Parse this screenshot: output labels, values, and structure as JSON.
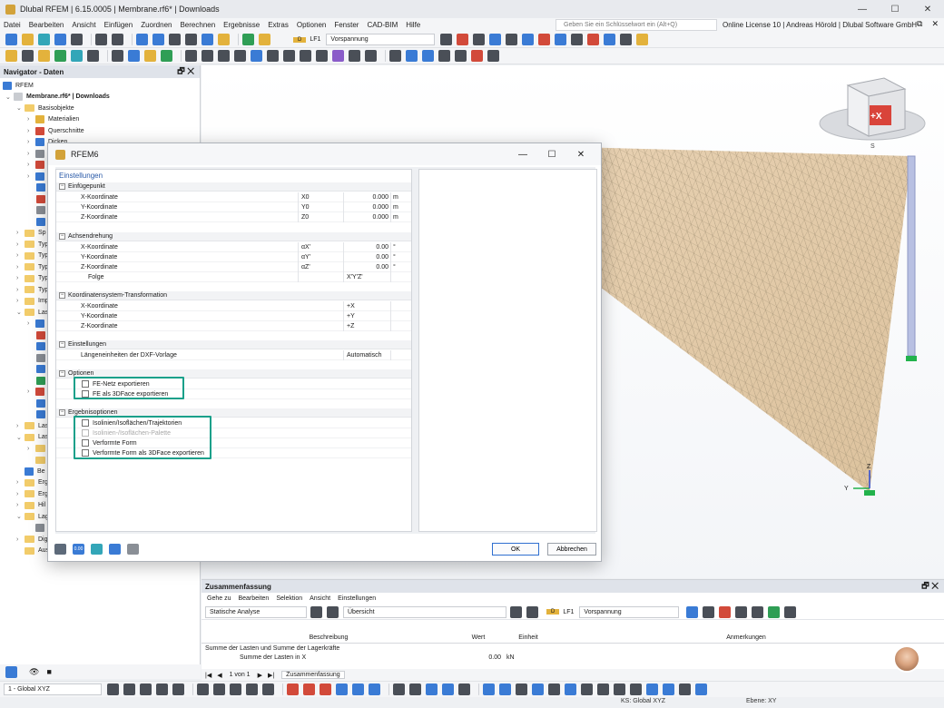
{
  "window": {
    "title": "Dlubal RFEM | 6.15.0005 | Membrane.rf6* | Downloads",
    "min": "—",
    "max": "☐",
    "close": "✕"
  },
  "menu": {
    "items": [
      "Datei",
      "Bearbeiten",
      "Ansicht",
      "Einfügen",
      "Zuordnen",
      "Berechnen",
      "Ergebnisse",
      "Extras",
      "Optionen",
      "Fenster",
      "CAD-BIM",
      "Hilfe"
    ],
    "search_placeholder": "Geben Sie ein Schlüsselwort ein (Alt+Q)",
    "license": "Online License 10 | Andreas Hörold | Dlubal Software GmbH"
  },
  "toolbar": {
    "lf_tag": "D",
    "lf_id": "LF1",
    "lf_name": "Vorspannung"
  },
  "navigator": {
    "title": "Navigator - Daten",
    "root": "RFEM",
    "model": "Membrane.rf6* | Downloads",
    "items": [
      "Basisobjekte",
      "Materialien",
      "Querschnitte",
      "Dicken",
      "Sp",
      "Typ",
      "Typ",
      "Typ",
      "Typ",
      "Typ",
      "Imp",
      "Las",
      "Las",
      "Las",
      "Be",
      "Erg",
      "Erg",
      "Hil",
      "Lag",
      "Dig",
      "Ausdruckprotokolle"
    ]
  },
  "viewport": {
    "cube_label": "+X",
    "cube_corner": "S",
    "axis_y": "Y",
    "axis_z": "Z"
  },
  "dialog": {
    "title": "RFEM6",
    "settings_title": "Einstellungen",
    "sections": {
      "insertion": "Einfügepunkt",
      "rotation": "Achsendrehung",
      "transform": "Koordinatensystem-Transformation",
      "settings": "Einstellungen",
      "options": "Optionen",
      "results": "Ergebnisoptionen"
    },
    "insertion_rows": [
      {
        "label": "X-Koordinate",
        "symbol": "X0",
        "value": "0.000",
        "unit": "m"
      },
      {
        "label": "Y-Koordinate",
        "symbol": "Y0",
        "value": "0.000",
        "unit": "m"
      },
      {
        "label": "Z-Koordinate",
        "symbol": "Z0",
        "value": "0.000",
        "unit": "m"
      }
    ],
    "rotation_rows": [
      {
        "label": "X-Koordinate",
        "symbol": "αX'",
        "value": "0.00",
        "unit": "°"
      },
      {
        "label": "Y-Koordinate",
        "symbol": "αY'",
        "value": "0.00",
        "unit": "°"
      },
      {
        "label": "Z-Koordinate",
        "symbol": "αZ'",
        "value": "0.00",
        "unit": "°"
      },
      {
        "label": "Folge",
        "symbol": "X'Y'Z'",
        "value": "",
        "unit": ""
      }
    ],
    "transform_rows": [
      {
        "label": "X-Koordinate",
        "symbol": "+X",
        "value": "",
        "unit": ""
      },
      {
        "label": "Y-Koordinate",
        "symbol": "+Y",
        "value": "",
        "unit": ""
      },
      {
        "label": "Z-Koordinate",
        "symbol": "+Z",
        "value": "",
        "unit": ""
      }
    ],
    "settings_rows": [
      {
        "label": "Längeneinheiten der DXF-Vorlage",
        "symbol": "Automatisch",
        "value": "",
        "unit": ""
      }
    ],
    "options_checks": [
      {
        "label": "FE-Netz exportieren",
        "disabled": false
      },
      {
        "label": "FE als 3DFace exportieren",
        "disabled": false
      }
    ],
    "results_checks": [
      {
        "label": "Isolinien/Isoflächen/Trajektorien",
        "disabled": false
      },
      {
        "label": "Isolinien-/Isoflächen-Palette",
        "disabled": true
      },
      {
        "label": "Verformte Form",
        "disabled": false
      },
      {
        "label": "Verformte Form als 3DFace exportieren",
        "disabled": false
      }
    ],
    "ok": "OK",
    "cancel": "Abbrechen",
    "footer_value": "0.00"
  },
  "bottom": {
    "title": "Zusammenfassung",
    "menu": [
      "Gehe zu",
      "Bearbeiten",
      "Selektion",
      "Ansicht",
      "Einstellungen"
    ],
    "analysis": "Statische Analyse",
    "overview": "Übersicht",
    "lf_tag": "D",
    "lf_id": "LF1",
    "lf_name": "Vorspannung",
    "columns": [
      "Beschreibung",
      "Wert",
      "Einheit",
      "Anmerkungen"
    ],
    "group": "Summe der Lasten und Summe der Lagerkräfte",
    "row": {
      "desc": "Summe der Lasten in X",
      "value": "0.00",
      "unit": "kN"
    },
    "pager": "1 von 1",
    "tab": "Zusammenfassung"
  },
  "status": {
    "cs_select": "1 - Global XYZ",
    "ks": "KS: Global XYZ",
    "plane": "Ebene: XY"
  }
}
